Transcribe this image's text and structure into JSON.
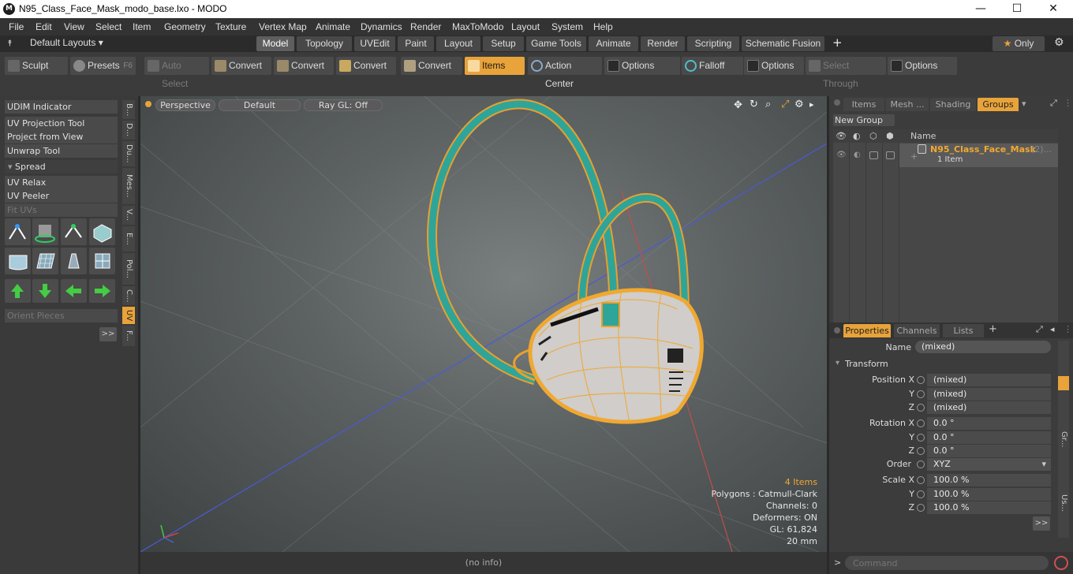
{
  "window": {
    "title": "N95_Class_Face_Mask_modo_base.lxo - MODO",
    "app_icon": "modo-logo-icon",
    "min": "—",
    "max": "☐",
    "close": "✕"
  },
  "menu": [
    "File",
    "Edit",
    "View",
    "Select",
    "Item",
    "Geometry",
    "Texture",
    "Vertex Map",
    "Animate",
    "Dynamics",
    "Render",
    "MaxToModo",
    "Layout",
    "System",
    "Help"
  ],
  "layouts": {
    "selector": "Default Layouts",
    "tabs": [
      "Model",
      "Topology",
      "UVEdit",
      "Paint",
      "Layout",
      "Setup",
      "Game Tools",
      "Animate",
      "Render",
      "Scripting",
      "Schematic Fusion"
    ],
    "active": "Model",
    "add": "+",
    "only": "Only",
    "star": "★",
    "gear": "⚙"
  },
  "toolbar": {
    "sculpt": "Sculpt",
    "presets": "Presets",
    "presets_key": "F6",
    "auto_select": "Auto Select",
    "convert1": "Convert",
    "convert2": "Convert",
    "convert3": "Convert",
    "convert4": "Convert",
    "items": "Items",
    "action_center": "Action Center",
    "options1": "Options",
    "falloff": "Falloff",
    "options2": "Options",
    "select_through": "Select Through",
    "options3": "Options"
  },
  "left_panel": {
    "udim": "UDIM Indicator",
    "uv_projection": "UV Projection Tool",
    "project_from_view": "Project from View",
    "unwrap": "Unwrap Tool",
    "spread": "Spread",
    "uv_relax": "UV Relax",
    "uv_peeler": "UV Peeler",
    "fit_uvs": "Fit UVs",
    "orient_pieces": "Orient Pieces",
    "more": ">>",
    "vtabs": [
      "B...",
      "D...",
      "Du...",
      "Mes...",
      "V...",
      "E...",
      "Pol...",
      "C...",
      "UV",
      "F..."
    ]
  },
  "viewport": {
    "perspective": "Perspective",
    "default": "Default",
    "raygl": "Ray GL: Off",
    "stats": {
      "items": "4 Items",
      "polygons": "Polygons : Catmull-Clark",
      "channels": "Channels: 0",
      "deformers": "Deformers: ON",
      "gl": "GL: 61,824",
      "scale": "20 mm"
    },
    "status": "(no info)"
  },
  "right_panel": {
    "tabs": [
      "Items",
      "Mesh ...",
      "Shading",
      "Groups"
    ],
    "active_tab": "Groups",
    "new_group": "New Group",
    "column_name": "Name",
    "group_name": "N95_Class_Face_Mask",
    "group_count": "(2)...",
    "group_sub": "1 Item",
    "prop_tabs": [
      "Properties",
      "Channels",
      "Lists"
    ],
    "add": "+",
    "name_label": "Name",
    "name_value": "(mixed)",
    "transform": "Transform",
    "position_label": "Position X",
    "pos_x": "(mixed)",
    "pos_y": "(mixed)",
    "pos_z": "(mixed)",
    "rotation_label": "Rotation X",
    "rot_x": "0.0 °",
    "rot_y": "0.0 °",
    "rot_z": "0.0 °",
    "order_label": "Order",
    "order_value": "XYZ",
    "scale_label": "Scale X",
    "scale_x": "100.0 %",
    "scale_y": "100.0 %",
    "scale_z": "100.0 %",
    "y": "Y",
    "z": "Z",
    "more": ">>",
    "side_gr": "Gr...",
    "side_us": "Us...",
    "command_prompt": ">",
    "command_placeholder": "Command"
  },
  "colors": {
    "accent": "#e8a33a",
    "teal": "#2fa59a",
    "wire": "#f0a830"
  }
}
